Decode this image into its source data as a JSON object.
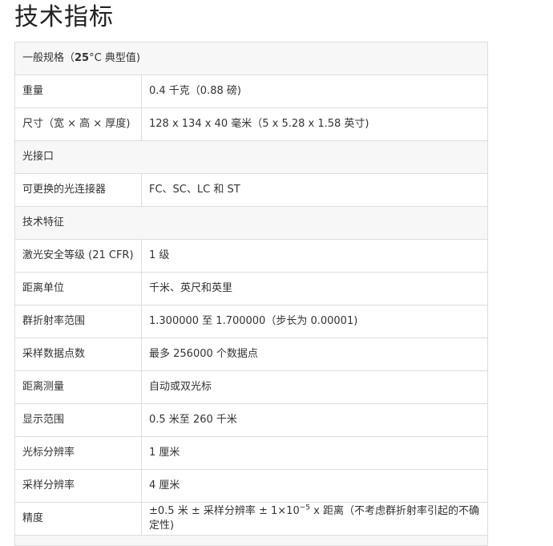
{
  "page": {
    "title": "技术指标"
  },
  "sections": {
    "general": {
      "label_prefix": "一般规格（",
      "label_bold": "25",
      "label_suffix": "°C 典型值)"
    },
    "optical_port": {
      "label": "光接口"
    },
    "technical": {
      "label": "技术特征"
    }
  },
  "rows": {
    "weight": {
      "label": "重量",
      "value": "0.4 千克（0.88 磅)"
    },
    "size": {
      "label": "尺寸（宽 × 高 × 厚度)",
      "value": "128 x 134 x 40 毫米（5 x 5.28 x 1.58 英寸)"
    },
    "connectors": {
      "label": "可更换的光连接器",
      "value": "FC、SC、LC 和 ST"
    },
    "laser_class": {
      "label": "激光安全等级 (21 CFR)",
      "value": "1 级"
    },
    "distance_unit": {
      "label": "距离单位",
      "value": "千米、英尺和英里"
    },
    "refractive_index": {
      "label": "群折射率范围",
      "value": "1.300000 至 1.700000（步长为 0.00001)"
    },
    "sample_points": {
      "label": "采样数据点数",
      "value": "最多 256000 个数据点"
    },
    "distance_measure": {
      "label": "距离测量",
      "value": "自动或双光标"
    },
    "display_range": {
      "label": "显示范围",
      "value": "0.5 米至 260 千米"
    },
    "cursor_resolution": {
      "label": "光标分辨率",
      "value": "1 厘米"
    },
    "sampling_resolution": {
      "label": "采样分辨率",
      "value": "4 厘米"
    },
    "accuracy": {
      "label": "精度",
      "value_part1": "±0.5 米 ± 采样分辨率 ± 1×10",
      "value_sup": "−5",
      "value_part2": " x 距离（不考虑群折射率引起的不确定性)"
    }
  }
}
